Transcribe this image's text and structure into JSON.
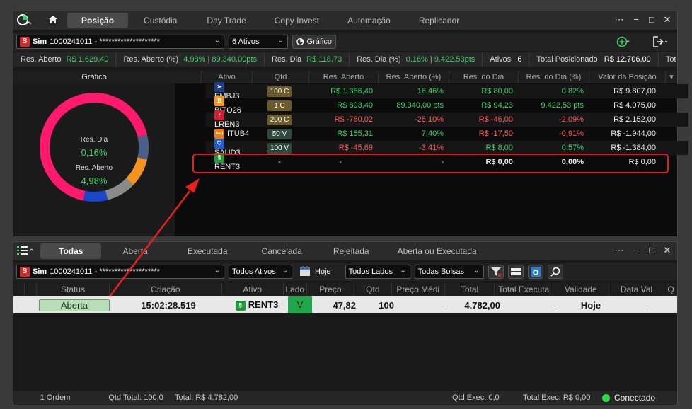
{
  "top_window": {
    "tabs": [
      "Posição",
      "Custódia",
      "Day Trade",
      "Copy Invest",
      "Automação",
      "Replicador"
    ],
    "active_tab": "Posição",
    "account_label": "Sim",
    "account_value": "1000241011 - ********************",
    "assets_select": "6 Ativos",
    "chart_button": "Gráfico",
    "summary": {
      "res_aberto_label": "Res. Aberto",
      "res_aberto_value": "R$ 1.629,40",
      "res_aberto_pct_label": "Res. Aberto (%)",
      "res_aberto_pct_value": "4,98%",
      "res_aberto_pts": "89.340,00pts",
      "res_dia_label": "Res. Dia",
      "res_dia_value": "R$ 118,73",
      "res_dia_pct_label": "Res. Dia (%)",
      "res_dia_pct_value": "0,16%",
      "res_dia_pts": "9.422,53pts",
      "ativos_label": "Ativos",
      "ativos_value": "6",
      "total_label": "Total Posicionado",
      "total_value": "R$ 12.706,00",
      "tot_label": "Tot"
    },
    "chart_panel": {
      "title": "Gráfico",
      "res_dia_label": "Res. Dia",
      "res_dia_value": "0,16%",
      "res_aberto_label": "Res. Aberto",
      "res_aberto_value": "4,98%"
    },
    "columns": [
      "Ativo",
      "Qtd",
      "Res. Aberto",
      "Res. Aberto (%)",
      "Res. do Dia",
      "Res. do Dia (%)",
      "Valor da Posição"
    ],
    "rows": [
      {
        "ativo": "EMBJ3",
        "qtd": "100 C",
        "res_aberto": "R$ 1.386,40",
        "res_aberto_pct": "16,46%",
        "res_dia": "R$ 80,00",
        "res_dia_pct": "0,82%",
        "valor": "R$ 9.807,00"
      },
      {
        "ativo": "BITQ26",
        "qtd": "1 C",
        "res_aberto": "R$ 893,40",
        "res_aberto_pct": "89.340,00 pts",
        "res_dia": "R$ 94,23",
        "res_dia_pct": "9.422,53 pts",
        "valor": "R$ 4.075,00"
      },
      {
        "ativo": "LREN3",
        "qtd": "200 C",
        "res_aberto": "R$ -760,02",
        "res_aberto_pct": "-26,10%",
        "res_dia": "R$ -46,00",
        "res_dia_pct": "-2,09%",
        "valor": "R$ 2.152,00"
      },
      {
        "ativo": "ITUB4",
        "qtd": "50 V",
        "res_aberto": "R$ 155,31",
        "res_aberto_pct": "7,40%",
        "res_dia": "R$ -17,50",
        "res_dia_pct": "-0,91%",
        "valor": "R$ -1.944,00"
      },
      {
        "ativo": "SAUD3",
        "qtd": "100 V",
        "res_aberto": "R$ -45,69",
        "res_aberto_pct": "-3,41%",
        "res_dia": "R$ 8,00",
        "res_dia_pct": "0,57%",
        "valor": "R$ -1.384,00"
      },
      {
        "ativo": "RENT3",
        "qtd": "-",
        "res_aberto": "-",
        "res_aberto_pct": "-",
        "res_dia": "R$ 0,00",
        "res_dia_pct": "0,00%",
        "valor": "R$ 0,00"
      }
    ]
  },
  "bottom_window": {
    "tabs": [
      "Todas",
      "Aberta",
      "Executada",
      "Cancelada",
      "Rejeitada",
      "Aberta ou Executada"
    ],
    "active_tab": "Todas",
    "account_label": "Sim",
    "account_value": "1000241011 - ********************",
    "filter_assets": "Todos Ativos",
    "date_label": "Hoje",
    "filter_sides": "Todos Lados",
    "filter_exchanges": "Todas Bolsas",
    "columns": [
      "Status",
      "Criação",
      "Ativo",
      "Lado",
      "Preço",
      "Qtd",
      "Preço Médi",
      "Total",
      "Total Executa",
      "Validade",
      "Data Val",
      "Q"
    ],
    "order": {
      "status": "Aberta",
      "criacao": "15:02:28.519",
      "ativo": "RENT3",
      "lado": "V",
      "preco": "47,82",
      "qtd": "100",
      "preco_medio": "-",
      "total": "4.782,00",
      "total_executado": "-",
      "validade": "Hoje",
      "data_val": "-"
    },
    "status_bar": {
      "orders": "1 Ordem",
      "qtd_total": "Qtd Total: 100,0",
      "total": "Total: R$ 4.782,00",
      "qtd_exec": "Qtd Exec: 0,0",
      "total_exec": "Total Exec: R$ 0,00",
      "connection": "Conectado"
    }
  },
  "colors": {
    "accent_green": "#3fd46a",
    "negative_red": "#ff5a5a",
    "highlight_border": "#e02020",
    "donut_pink": "#ff1a6e",
    "donut_orange": "#f3941e",
    "donut_gray": "#8a8a8a",
    "donut_blue": "#1a47c8",
    "donut_slate": "#4a5f8a"
  }
}
